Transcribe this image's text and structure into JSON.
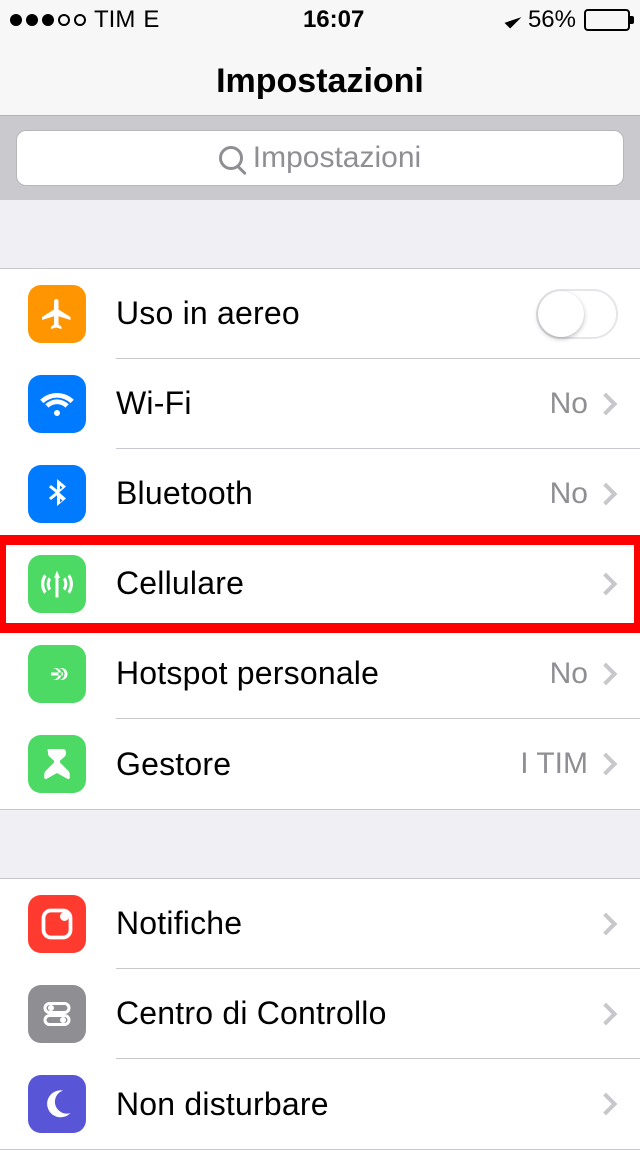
{
  "status": {
    "carrier": "TIM",
    "network": "E",
    "time": "16:07",
    "battery_pct": "56%",
    "battery_level_css": "56%"
  },
  "header": {
    "title": "Impostazioni"
  },
  "search": {
    "placeholder": "Impostazioni"
  },
  "groups": [
    {
      "rows": [
        {
          "id": "airplane",
          "icon_bg": "#ff9500",
          "label": "Uso in aereo",
          "type": "switch",
          "switch_on": false
        },
        {
          "id": "wifi",
          "icon_bg": "#007aff",
          "label": "Wi-Fi",
          "type": "link",
          "value": "No"
        },
        {
          "id": "bluetooth",
          "icon_bg": "#007aff",
          "label": "Bluetooth",
          "type": "link",
          "value": "No"
        },
        {
          "id": "cellular",
          "icon_bg": "#4cd964",
          "label": "Cellulare",
          "type": "link",
          "highlight": true
        },
        {
          "id": "hotspot",
          "icon_bg": "#4cd964",
          "label": "Hotspot personale",
          "type": "link",
          "value": "No"
        },
        {
          "id": "carrier",
          "icon_bg": "#4cd964",
          "label": "Gestore",
          "type": "link",
          "value": "I TIM"
        }
      ]
    },
    {
      "rows": [
        {
          "id": "notifications",
          "icon_bg": "#ff3b30",
          "label": "Notifiche",
          "type": "link"
        },
        {
          "id": "control-center",
          "icon_bg": "#8e8e93",
          "label": "Centro di Controllo",
          "type": "link"
        },
        {
          "id": "dnd",
          "icon_bg": "#5856d6",
          "label": "Non disturbare",
          "type": "link"
        }
      ]
    }
  ]
}
